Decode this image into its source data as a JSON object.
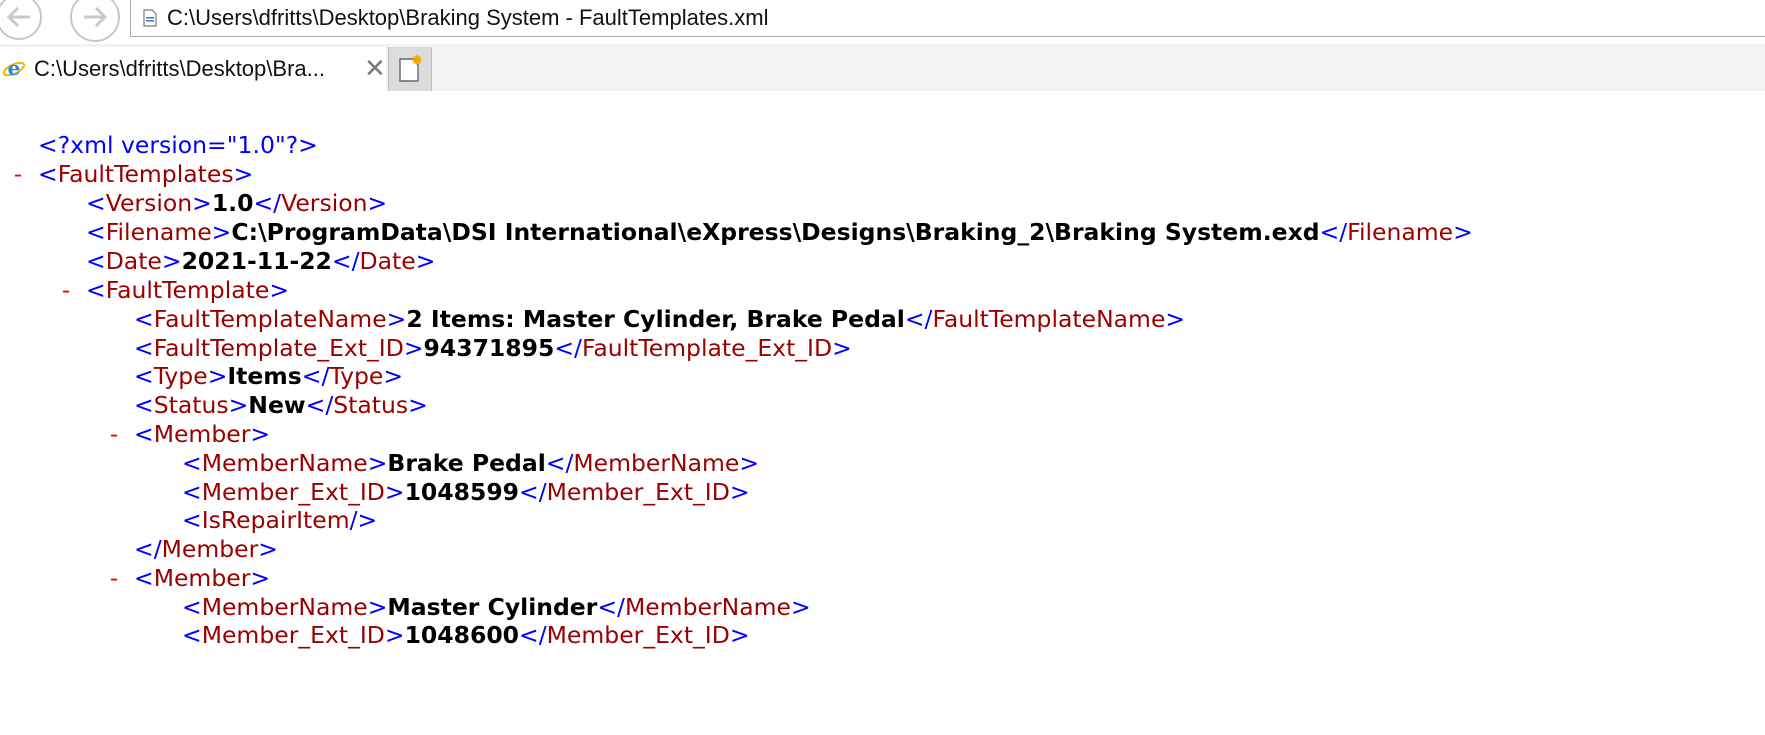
{
  "window": {
    "address": "C:\\Users\\dfritts\\Desktop\\Braking System - FaultTemplates.xml",
    "tab_title": "C:\\Users\\dfritts\\Desktop\\Bra...",
    "tab_close": "✕"
  },
  "xml": {
    "declaration": "<?xml version=\"1.0\"?>",
    "toggle": "-",
    "lt": "<",
    "gt": ">",
    "close_open": "</",
    "self_close": "/>",
    "root_tag": "FaultTemplates",
    "version_tag": "Version",
    "version_value": "1.0",
    "filename_tag": "Filename",
    "filename_value": "C:\\ProgramData\\DSI International\\eXpress\\Designs\\Braking_2\\Braking System.exd",
    "date_tag": "Date",
    "date_value": "2021-11-22",
    "template_tag": "FaultTemplate",
    "template_name_tag": "FaultTemplateName",
    "template_name_value": "2 Items: Master Cylinder, Brake Pedal",
    "template_ext_id_tag": "FaultTemplate_Ext_ID",
    "template_ext_id_value": "94371895",
    "type_tag": "Type",
    "type_value": "Items",
    "status_tag": "Status",
    "status_value": "New",
    "member_tag": "Member",
    "member_name_tag": "MemberName",
    "member_ext_id_tag": "Member_Ext_ID",
    "repair_tag": "IsRepairItem",
    "members": [
      {
        "name": "Brake Pedal",
        "ext_id": "1048599"
      },
      {
        "name": "Master Cylinder",
        "ext_id": "1048600"
      }
    ]
  }
}
